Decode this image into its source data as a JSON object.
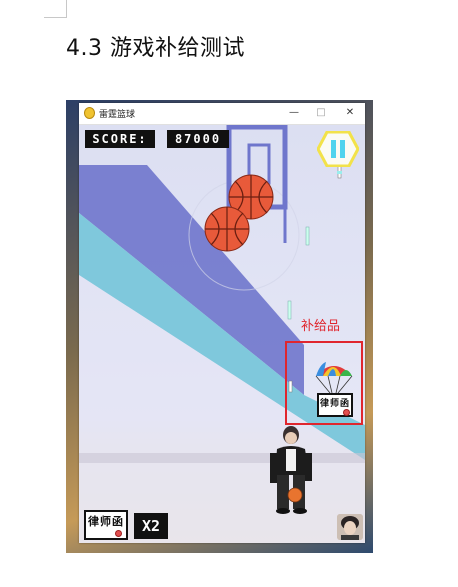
{
  "document": {
    "heading": "4.3  游戏补给测试"
  },
  "window": {
    "title": "雷霆篮球",
    "controls": {
      "minimize": "—",
      "maximize": "□",
      "close": "✕"
    }
  },
  "game": {
    "score_label": "SCORE:",
    "score_value": "87000",
    "pause_icon": "pause-icon",
    "annotation": "补给品",
    "supply_card_text": "律师函",
    "lives_card_text": "律师函",
    "lives_multiplier": "X2"
  },
  "colors": {
    "annotation_red": "#e0262e",
    "pause_hex": "#f2e24a",
    "pause_bars": "#4fd3ee",
    "basketball": "#e85a3a",
    "window_bg": "#e7e8f4"
  }
}
